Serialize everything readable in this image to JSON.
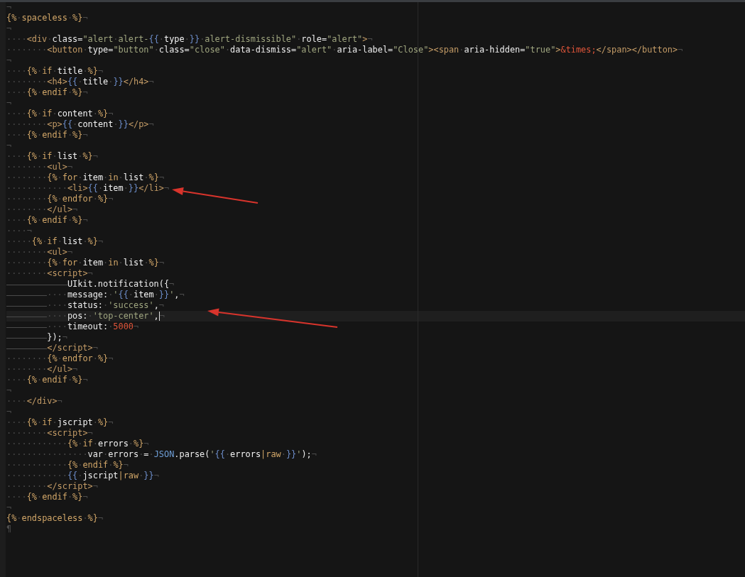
{
  "lines": [
    {
      "segs": [
        {
          "kind": "ws",
          "text": "¬"
        }
      ]
    },
    {
      "segs": [
        {
          "kind": "twig",
          "text": "{%"
        },
        {
          "kind": "ws",
          "text": "·"
        },
        {
          "kind": "twig",
          "text": "spaceless"
        },
        {
          "kind": "ws",
          "text": "·"
        },
        {
          "kind": "twig",
          "text": "%}"
        },
        {
          "kind": "ws",
          "text": "¬"
        }
      ]
    },
    {
      "segs": [
        {
          "kind": "ws",
          "text": "¬"
        }
      ]
    },
    {
      "segs": [
        {
          "kind": "ws",
          "text": "····"
        },
        {
          "kind": "tag",
          "text": "<div"
        },
        {
          "kind": "ws",
          "text": "·"
        },
        {
          "kind": "attr",
          "text": "class="
        },
        {
          "kind": "str",
          "text": "\"alert"
        },
        {
          "kind": "ws",
          "text": "·"
        },
        {
          "kind": "str",
          "text": "alert-"
        },
        {
          "kind": "brace",
          "text": "{{"
        },
        {
          "kind": "ws",
          "text": "·"
        },
        {
          "kind": "var",
          "text": "type"
        },
        {
          "kind": "ws",
          "text": "·"
        },
        {
          "kind": "brace",
          "text": "}}"
        },
        {
          "kind": "ws",
          "text": "·"
        },
        {
          "kind": "str",
          "text": "alert-dismissible\""
        },
        {
          "kind": "ws",
          "text": "·"
        },
        {
          "kind": "attr",
          "text": "role="
        },
        {
          "kind": "str",
          "text": "\"alert\""
        },
        {
          "kind": "tag",
          "text": ">"
        },
        {
          "kind": "ws",
          "text": "¬"
        }
      ]
    },
    {
      "segs": [
        {
          "kind": "ws",
          "text": "········"
        },
        {
          "kind": "tag",
          "text": "<button"
        },
        {
          "kind": "ws",
          "text": "·"
        },
        {
          "kind": "attr",
          "text": "type="
        },
        {
          "kind": "str",
          "text": "\"button\""
        },
        {
          "kind": "ws",
          "text": "·"
        },
        {
          "kind": "attr",
          "text": "class="
        },
        {
          "kind": "str",
          "text": "\"close\""
        },
        {
          "kind": "ws",
          "text": "·"
        },
        {
          "kind": "attr",
          "text": "data-dismiss="
        },
        {
          "kind": "str",
          "text": "\"alert\""
        },
        {
          "kind": "ws",
          "text": "·"
        },
        {
          "kind": "attr",
          "text": "aria-label="
        },
        {
          "kind": "str",
          "text": "\"Close\""
        },
        {
          "kind": "tag",
          "text": "><span"
        },
        {
          "kind": "ws",
          "text": "·"
        },
        {
          "kind": "attr",
          "text": "aria-hidden="
        },
        {
          "kind": "str",
          "text": "\"true\""
        },
        {
          "kind": "tag",
          "text": ">"
        },
        {
          "kind": "ent",
          "text": "&times;"
        },
        {
          "kind": "tag",
          "text": "</span></button>"
        },
        {
          "kind": "ws",
          "text": "¬"
        }
      ]
    },
    {
      "segs": [
        {
          "kind": "ws",
          "text": "¬"
        }
      ]
    },
    {
      "segs": [
        {
          "kind": "ws",
          "text": "····"
        },
        {
          "kind": "twig",
          "text": "{%"
        },
        {
          "kind": "ws",
          "text": "·"
        },
        {
          "kind": "twig",
          "text": "if"
        },
        {
          "kind": "ws",
          "text": "·"
        },
        {
          "kind": "var",
          "text": "title"
        },
        {
          "kind": "ws",
          "text": "·"
        },
        {
          "kind": "twig",
          "text": "%}"
        },
        {
          "kind": "ws",
          "text": "¬"
        }
      ]
    },
    {
      "segs": [
        {
          "kind": "ws",
          "text": "········"
        },
        {
          "kind": "tag",
          "text": "<h4>"
        },
        {
          "kind": "brace",
          "text": "{{"
        },
        {
          "kind": "ws",
          "text": "·"
        },
        {
          "kind": "var",
          "text": "title"
        },
        {
          "kind": "ws",
          "text": "·"
        },
        {
          "kind": "brace",
          "text": "}}"
        },
        {
          "kind": "tag",
          "text": "</h4>"
        },
        {
          "kind": "ws",
          "text": "¬"
        }
      ]
    },
    {
      "segs": [
        {
          "kind": "ws",
          "text": "····"
        },
        {
          "kind": "twig",
          "text": "{%"
        },
        {
          "kind": "ws",
          "text": "·"
        },
        {
          "kind": "twig",
          "text": "endif"
        },
        {
          "kind": "ws",
          "text": "·"
        },
        {
          "kind": "twig",
          "text": "%}"
        },
        {
          "kind": "ws",
          "text": "¬"
        }
      ]
    },
    {
      "segs": [
        {
          "kind": "ws",
          "text": "¬"
        }
      ]
    },
    {
      "segs": [
        {
          "kind": "ws",
          "text": "····"
        },
        {
          "kind": "twig",
          "text": "{%"
        },
        {
          "kind": "ws",
          "text": "·"
        },
        {
          "kind": "twig",
          "text": "if"
        },
        {
          "kind": "ws",
          "text": "·"
        },
        {
          "kind": "var",
          "text": "content"
        },
        {
          "kind": "ws",
          "text": "·"
        },
        {
          "kind": "twig",
          "text": "%}"
        },
        {
          "kind": "ws",
          "text": "¬"
        }
      ]
    },
    {
      "segs": [
        {
          "kind": "ws",
          "text": "········"
        },
        {
          "kind": "tag",
          "text": "<p>"
        },
        {
          "kind": "brace",
          "text": "{{"
        },
        {
          "kind": "ws",
          "text": "·"
        },
        {
          "kind": "var",
          "text": "content"
        },
        {
          "kind": "ws",
          "text": "·"
        },
        {
          "kind": "brace",
          "text": "}}"
        },
        {
          "kind": "tag",
          "text": "</p>"
        },
        {
          "kind": "ws",
          "text": "¬"
        }
      ]
    },
    {
      "segs": [
        {
          "kind": "ws",
          "text": "····"
        },
        {
          "kind": "twig",
          "text": "{%"
        },
        {
          "kind": "ws",
          "text": "·"
        },
        {
          "kind": "twig",
          "text": "endif"
        },
        {
          "kind": "ws",
          "text": "·"
        },
        {
          "kind": "twig",
          "text": "%}"
        },
        {
          "kind": "ws",
          "text": "¬"
        }
      ]
    },
    {
      "segs": [
        {
          "kind": "ws",
          "text": "¬"
        }
      ]
    },
    {
      "segs": [
        {
          "kind": "ws",
          "text": "····"
        },
        {
          "kind": "twig",
          "text": "{%"
        },
        {
          "kind": "ws",
          "text": "·"
        },
        {
          "kind": "twig",
          "text": "if"
        },
        {
          "kind": "ws",
          "text": "·"
        },
        {
          "kind": "var",
          "text": "list"
        },
        {
          "kind": "ws",
          "text": "·"
        },
        {
          "kind": "twig",
          "text": "%}"
        },
        {
          "kind": "ws",
          "text": "¬"
        }
      ]
    },
    {
      "segs": [
        {
          "kind": "ws",
          "text": "········"
        },
        {
          "kind": "tag",
          "text": "<ul>"
        },
        {
          "kind": "ws",
          "text": "¬"
        }
      ]
    },
    {
      "segs": [
        {
          "kind": "ws",
          "text": "········"
        },
        {
          "kind": "twig",
          "text": "{%"
        },
        {
          "kind": "ws",
          "text": "·"
        },
        {
          "kind": "twig",
          "text": "for"
        },
        {
          "kind": "ws",
          "text": "·"
        },
        {
          "kind": "var",
          "text": "item"
        },
        {
          "kind": "ws",
          "text": "·"
        },
        {
          "kind": "twig",
          "text": "in"
        },
        {
          "kind": "ws",
          "text": "·"
        },
        {
          "kind": "var",
          "text": "list"
        },
        {
          "kind": "ws",
          "text": "·"
        },
        {
          "kind": "twig",
          "text": "%}"
        },
        {
          "kind": "ws",
          "text": "¬"
        }
      ]
    },
    {
      "segs": [
        {
          "kind": "ws",
          "text": "············"
        },
        {
          "kind": "tag",
          "text": "<li>"
        },
        {
          "kind": "brace",
          "text": "{{"
        },
        {
          "kind": "ws",
          "text": "·"
        },
        {
          "kind": "var",
          "text": "item"
        },
        {
          "kind": "ws",
          "text": "·"
        },
        {
          "kind": "brace",
          "text": "}}"
        },
        {
          "kind": "tag",
          "text": "</li>"
        },
        {
          "kind": "ws",
          "text": "¬"
        }
      ],
      "arrow": true
    },
    {
      "segs": [
        {
          "kind": "ws",
          "text": "········"
        },
        {
          "kind": "twig",
          "text": "{%"
        },
        {
          "kind": "ws",
          "text": "·"
        },
        {
          "kind": "twig",
          "text": "endfor"
        },
        {
          "kind": "ws",
          "text": "·"
        },
        {
          "kind": "twig",
          "text": "%}"
        },
        {
          "kind": "ws",
          "text": "¬"
        }
      ]
    },
    {
      "segs": [
        {
          "kind": "ws",
          "text": "········"
        },
        {
          "kind": "tag",
          "text": "</ul>"
        },
        {
          "kind": "ws",
          "text": "¬"
        }
      ]
    },
    {
      "segs": [
        {
          "kind": "ws",
          "text": "····"
        },
        {
          "kind": "twig",
          "text": "{%"
        },
        {
          "kind": "ws",
          "text": "·"
        },
        {
          "kind": "twig",
          "text": "endif"
        },
        {
          "kind": "ws",
          "text": "·"
        },
        {
          "kind": "twig",
          "text": "%}"
        },
        {
          "kind": "ws",
          "text": "¬"
        }
      ]
    },
    {
      "segs": [
        {
          "kind": "ws",
          "text": "····¬"
        }
      ]
    },
    {
      "segs": [
        {
          "kind": "ws",
          "text": "·····"
        },
        {
          "kind": "twig",
          "text": "{%"
        },
        {
          "kind": "ws",
          "text": "·"
        },
        {
          "kind": "twig",
          "text": "if"
        },
        {
          "kind": "ws",
          "text": "·"
        },
        {
          "kind": "var",
          "text": "list"
        },
        {
          "kind": "ws",
          "text": "·"
        },
        {
          "kind": "twig",
          "text": "%}"
        },
        {
          "kind": "ws",
          "text": "¬"
        }
      ]
    },
    {
      "segs": [
        {
          "kind": "ws",
          "text": "········"
        },
        {
          "kind": "tag",
          "text": "<ul>"
        },
        {
          "kind": "ws",
          "text": "¬"
        }
      ]
    },
    {
      "segs": [
        {
          "kind": "ws",
          "text": "········"
        },
        {
          "kind": "twig",
          "text": "{%"
        },
        {
          "kind": "ws",
          "text": "·"
        },
        {
          "kind": "twig",
          "text": "for"
        },
        {
          "kind": "ws",
          "text": "·"
        },
        {
          "kind": "var",
          "text": "item"
        },
        {
          "kind": "ws",
          "text": "·"
        },
        {
          "kind": "twig",
          "text": "in"
        },
        {
          "kind": "ws",
          "text": "·"
        },
        {
          "kind": "var",
          "text": "list"
        },
        {
          "kind": "ws",
          "text": "·"
        },
        {
          "kind": "twig",
          "text": "%}"
        },
        {
          "kind": "ws",
          "text": "¬"
        }
      ]
    },
    {
      "segs": [
        {
          "kind": "ws",
          "text": "········"
        },
        {
          "kind": "tag",
          "text": "<script>"
        },
        {
          "kind": "ws",
          "text": "¬"
        }
      ]
    },
    {
      "segs": [
        {
          "kind": "tab"
        },
        {
          "kind": "tab"
        },
        {
          "kind": "tab"
        },
        {
          "kind": "plain",
          "text": "UIkit.notification({"
        },
        {
          "kind": "ws",
          "text": "¬"
        }
      ]
    },
    {
      "segs": [
        {
          "kind": "tab"
        },
        {
          "kind": "tab"
        },
        {
          "kind": "ws",
          "text": "····"
        },
        {
          "kind": "plain",
          "text": "message:"
        },
        {
          "kind": "ws",
          "text": "·"
        },
        {
          "kind": "str",
          "text": "'"
        },
        {
          "kind": "brace",
          "text": "{{"
        },
        {
          "kind": "ws",
          "text": "·"
        },
        {
          "kind": "var",
          "text": "item"
        },
        {
          "kind": "ws",
          "text": "·"
        },
        {
          "kind": "brace",
          "text": "}}"
        },
        {
          "kind": "str",
          "text": "'"
        },
        {
          "kind": "plain",
          "text": ","
        },
        {
          "kind": "ws",
          "text": "¬"
        }
      ]
    },
    {
      "segs": [
        {
          "kind": "tab"
        },
        {
          "kind": "tab"
        },
        {
          "kind": "ws",
          "text": "····"
        },
        {
          "kind": "plain",
          "text": "status:"
        },
        {
          "kind": "ws",
          "text": "·"
        },
        {
          "kind": "str",
          "text": "'success'"
        },
        {
          "kind": "plain",
          "text": ","
        },
        {
          "kind": "ws",
          "text": "¬"
        }
      ]
    },
    {
      "segs": [
        {
          "kind": "tab"
        },
        {
          "kind": "tab"
        },
        {
          "kind": "ws",
          "text": "····"
        },
        {
          "kind": "plain",
          "text": "pos:"
        },
        {
          "kind": "ws",
          "text": "·"
        },
        {
          "kind": "str",
          "text": "'top-center'"
        },
        {
          "kind": "plain",
          "text": ","
        },
        {
          "kind": "caret"
        },
        {
          "kind": "ws",
          "text": "¬"
        }
      ],
      "current": true,
      "arrow": true
    },
    {
      "segs": [
        {
          "kind": "tab"
        },
        {
          "kind": "tab"
        },
        {
          "kind": "ws",
          "text": "····"
        },
        {
          "kind": "plain",
          "text": "timeout:"
        },
        {
          "kind": "ws",
          "text": "·"
        },
        {
          "kind": "ent",
          "text": "5000"
        },
        {
          "kind": "ws",
          "text": "¬"
        }
      ]
    },
    {
      "segs": [
        {
          "kind": "tab"
        },
        {
          "kind": "tab"
        },
        {
          "kind": "plain",
          "text": "});"
        },
        {
          "kind": "ws",
          "text": "¬"
        }
      ]
    },
    {
      "segs": [
        {
          "kind": "tab"
        },
        {
          "kind": "tab"
        },
        {
          "kind": "tag",
          "text": "</script>"
        },
        {
          "kind": "ws",
          "text": "¬"
        }
      ]
    },
    {
      "segs": [
        {
          "kind": "ws",
          "text": "········"
        },
        {
          "kind": "twig",
          "text": "{%"
        },
        {
          "kind": "ws",
          "text": "·"
        },
        {
          "kind": "twig",
          "text": "endfor"
        },
        {
          "kind": "ws",
          "text": "·"
        },
        {
          "kind": "twig",
          "text": "%}"
        },
        {
          "kind": "ws",
          "text": "¬"
        }
      ]
    },
    {
      "segs": [
        {
          "kind": "ws",
          "text": "········"
        },
        {
          "kind": "tag",
          "text": "</ul>"
        },
        {
          "kind": "ws",
          "text": "¬"
        }
      ]
    },
    {
      "segs": [
        {
          "kind": "ws",
          "text": "····"
        },
        {
          "kind": "twig",
          "text": "{%"
        },
        {
          "kind": "ws",
          "text": "·"
        },
        {
          "kind": "twig",
          "text": "endif"
        },
        {
          "kind": "ws",
          "text": "·"
        },
        {
          "kind": "twig",
          "text": "%}"
        },
        {
          "kind": "ws",
          "text": "¬"
        }
      ]
    },
    {
      "segs": [
        {
          "kind": "ws",
          "text": "¬"
        }
      ]
    },
    {
      "segs": [
        {
          "kind": "ws",
          "text": "····"
        },
        {
          "kind": "tag",
          "text": "</div>"
        },
        {
          "kind": "ws",
          "text": "¬"
        }
      ]
    },
    {
      "segs": [
        {
          "kind": "ws",
          "text": "¬"
        }
      ]
    },
    {
      "segs": [
        {
          "kind": "ws",
          "text": "····"
        },
        {
          "kind": "twig",
          "text": "{%"
        },
        {
          "kind": "ws",
          "text": "·"
        },
        {
          "kind": "twig",
          "text": "if"
        },
        {
          "kind": "ws",
          "text": "·"
        },
        {
          "kind": "var",
          "text": "jscript"
        },
        {
          "kind": "ws",
          "text": "·"
        },
        {
          "kind": "twig",
          "text": "%}"
        },
        {
          "kind": "ws",
          "text": "¬"
        }
      ]
    },
    {
      "segs": [
        {
          "kind": "ws",
          "text": "········"
        },
        {
          "kind": "tag",
          "text": "<script>"
        },
        {
          "kind": "ws",
          "text": "¬"
        }
      ]
    },
    {
      "segs": [
        {
          "kind": "ws",
          "text": "············"
        },
        {
          "kind": "twig",
          "text": "{%"
        },
        {
          "kind": "ws",
          "text": "·"
        },
        {
          "kind": "twig",
          "text": "if"
        },
        {
          "kind": "ws",
          "text": "·"
        },
        {
          "kind": "var",
          "text": "errors"
        },
        {
          "kind": "ws",
          "text": "·"
        },
        {
          "kind": "twig",
          "text": "%}"
        },
        {
          "kind": "ws",
          "text": "¬"
        }
      ]
    },
    {
      "segs": [
        {
          "kind": "ws",
          "text": "················"
        },
        {
          "kind": "plain",
          "text": "var"
        },
        {
          "kind": "ws",
          "text": "·"
        },
        {
          "kind": "plain",
          "text": "errors"
        },
        {
          "kind": "ws",
          "text": "·"
        },
        {
          "kind": "plain",
          "text": "="
        },
        {
          "kind": "ws",
          "text": "·"
        },
        {
          "kind": "json",
          "text": "JSON"
        },
        {
          "kind": "plain",
          "text": ".parse("
        },
        {
          "kind": "str",
          "text": "'"
        },
        {
          "kind": "brace",
          "text": "{{"
        },
        {
          "kind": "ws",
          "text": "·"
        },
        {
          "kind": "var",
          "text": "errors"
        },
        {
          "kind": "twig",
          "text": "|raw"
        },
        {
          "kind": "ws",
          "text": "·"
        },
        {
          "kind": "brace",
          "text": "}}"
        },
        {
          "kind": "str",
          "text": "'"
        },
        {
          "kind": "plain",
          "text": ");"
        },
        {
          "kind": "ws",
          "text": "¬"
        }
      ]
    },
    {
      "segs": [
        {
          "kind": "ws",
          "text": "············"
        },
        {
          "kind": "twig",
          "text": "{%"
        },
        {
          "kind": "ws",
          "text": "·"
        },
        {
          "kind": "twig",
          "text": "endif"
        },
        {
          "kind": "ws",
          "text": "·"
        },
        {
          "kind": "twig",
          "text": "%}"
        },
        {
          "kind": "ws",
          "text": "¬"
        }
      ]
    },
    {
      "segs": [
        {
          "kind": "ws",
          "text": "············"
        },
        {
          "kind": "brace",
          "text": "{{"
        },
        {
          "kind": "ws",
          "text": "·"
        },
        {
          "kind": "var",
          "text": "jscript"
        },
        {
          "kind": "twig",
          "text": "|raw"
        },
        {
          "kind": "ws",
          "text": "·"
        },
        {
          "kind": "brace",
          "text": "}}"
        },
        {
          "kind": "ws",
          "text": "¬"
        }
      ]
    },
    {
      "segs": [
        {
          "kind": "ws",
          "text": "········"
        },
        {
          "kind": "tag",
          "text": "</script>"
        },
        {
          "kind": "ws",
          "text": "¬"
        }
      ]
    },
    {
      "segs": [
        {
          "kind": "ws",
          "text": "····"
        },
        {
          "kind": "twig",
          "text": "{%"
        },
        {
          "kind": "ws",
          "text": "·"
        },
        {
          "kind": "twig",
          "text": "endif"
        },
        {
          "kind": "ws",
          "text": "·"
        },
        {
          "kind": "twig",
          "text": "%}"
        },
        {
          "kind": "ws",
          "text": "¬"
        }
      ]
    },
    {
      "segs": [
        {
          "kind": "ws",
          "text": "¬"
        }
      ]
    },
    {
      "segs": [
        {
          "kind": "twig",
          "text": "{%"
        },
        {
          "kind": "ws",
          "text": "·"
        },
        {
          "kind": "twig",
          "text": "endspaceless"
        },
        {
          "kind": "ws",
          "text": "·"
        },
        {
          "kind": "twig",
          "text": "%}"
        },
        {
          "kind": "ws",
          "text": "¬"
        }
      ]
    },
    {
      "segs": [
        {
          "kind": "ws",
          "text": "¶"
        }
      ]
    }
  ]
}
